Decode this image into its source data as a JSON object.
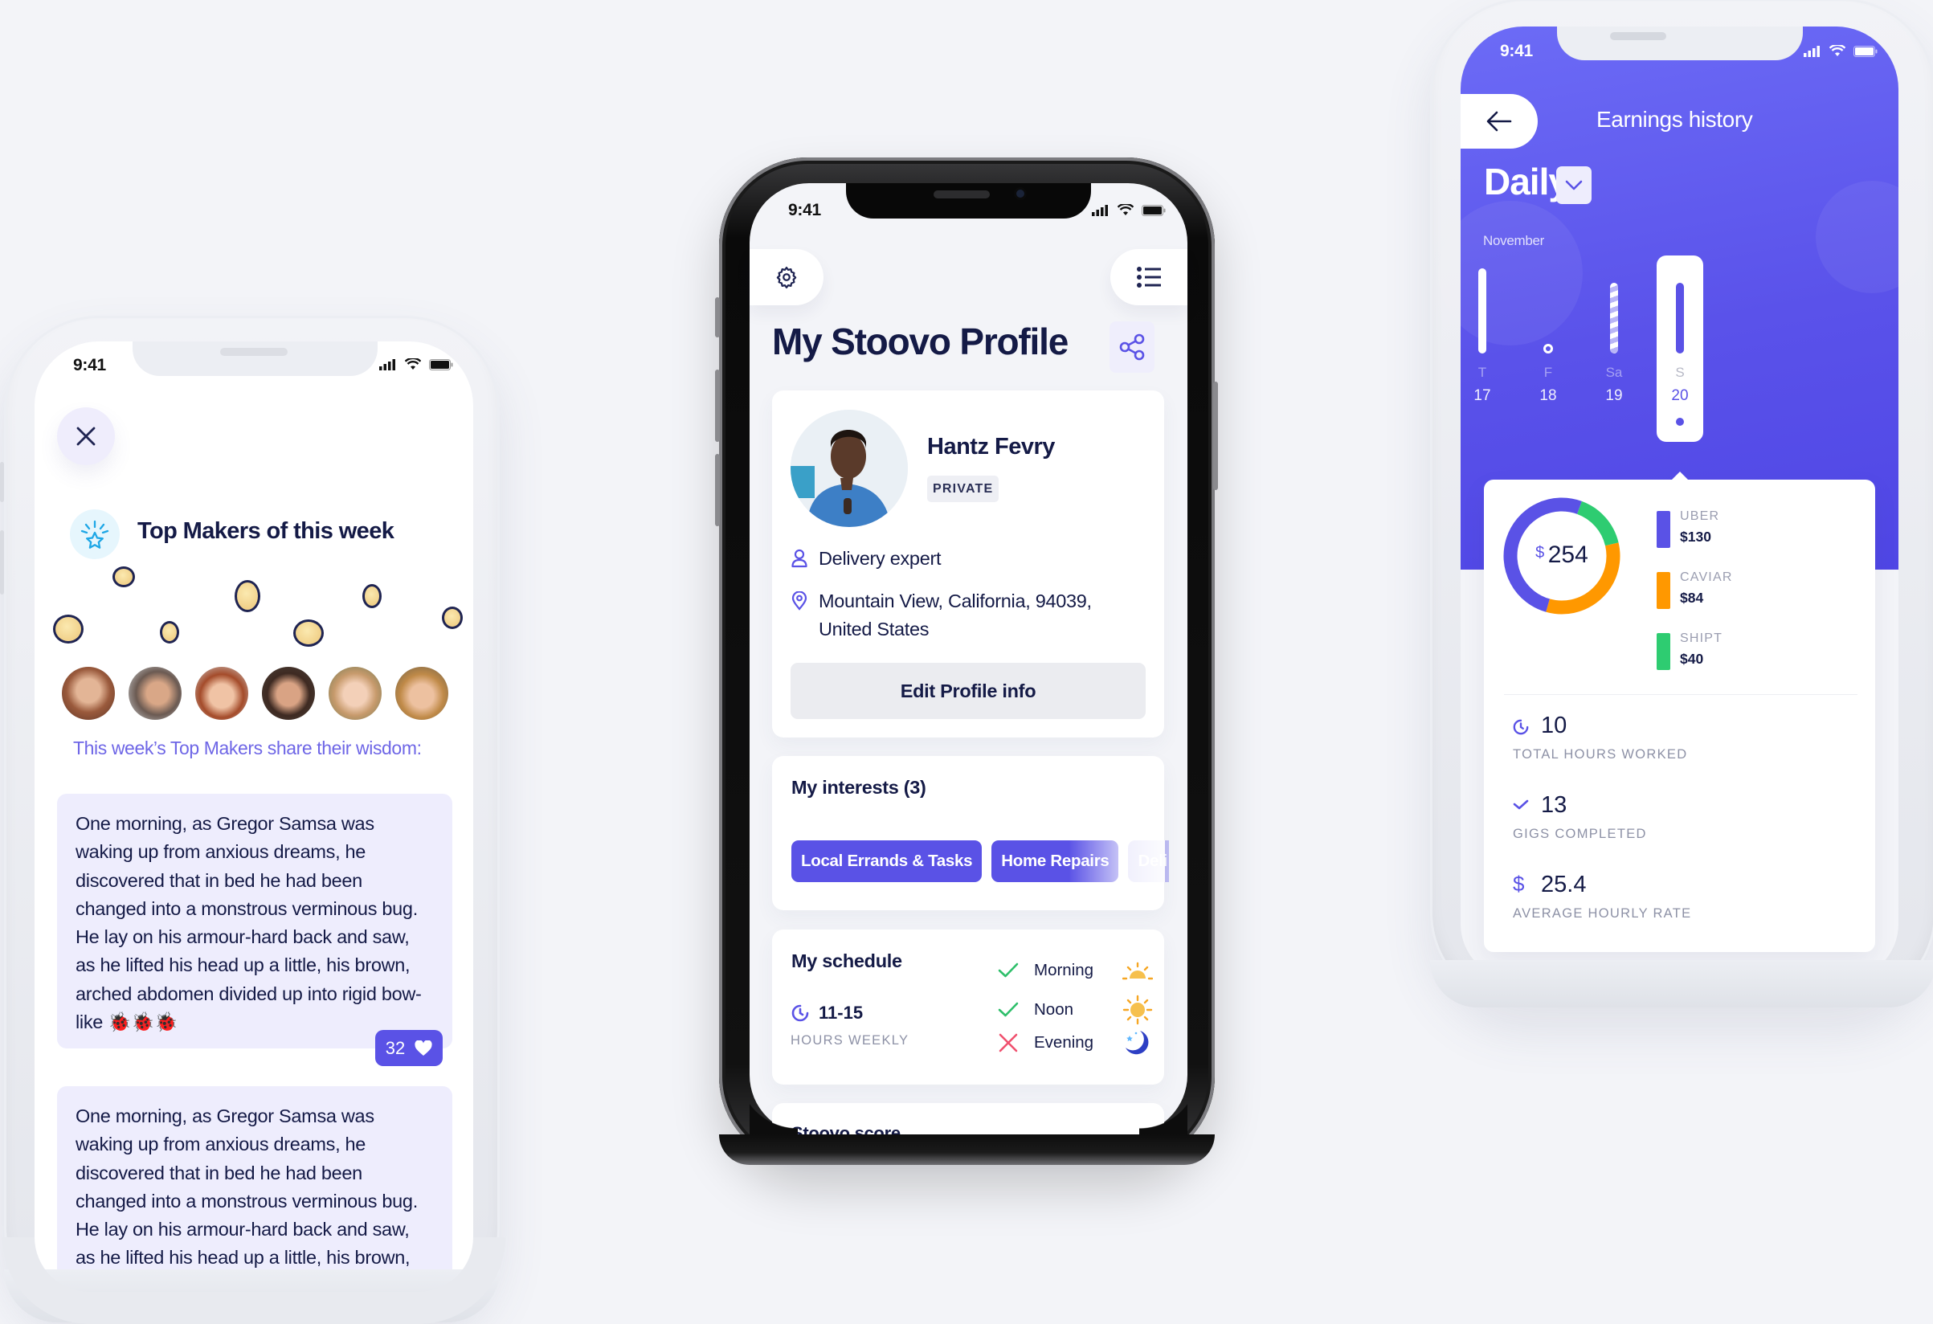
{
  "status_bar": {
    "time": "9:41"
  },
  "top_makers": {
    "title": "Top Makers of this week",
    "subtitle": "This week’s Top Makers share their wisdom:",
    "close_icon": "close-icon",
    "avatars": [
      "maker-1",
      "maker-2",
      "maker-3",
      "maker-4",
      "maker-5",
      "maker-6"
    ],
    "posts": [
      {
        "text": "One morning, as Gregor Samsa was waking up from anxious dreams, he discovered that in bed he had been changed into a monstrous verminous bug. He lay on his armour-hard back and saw, as he lifted his head up a little, his brown, arched abdomen divided up into rigid bow-like 🐞🐞🐞",
        "likes": "32"
      },
      {
        "text": "One morning, as Gregor Samsa was waking up from anxious dreams, he discovered that in bed he had been changed into a monstrous verminous bug. He lay on his armour-hard back and saw, as he lifted his head up a little, his brown, arched abdomen divided up into rigid"
      }
    ]
  },
  "profile": {
    "title": "My Stoovo Profile",
    "name": "Hantz Fevry",
    "badge": "PRIVATE",
    "role": "Delivery expert",
    "location_line1": "Mountain View, California, 94039,",
    "location_line2": "United States",
    "edit_button": "Edit Profile info",
    "interests_title": "My interests (3)",
    "interests": [
      "Local Errands & Tasks",
      "Home Repairs",
      "Deli"
    ],
    "schedule_title": "My schedule",
    "hours_value": "11-15",
    "hours_label": "HOURS WEEKLY",
    "schedule": [
      {
        "label": "Morning",
        "enabled": true,
        "icon": "sunrise-icon"
      },
      {
        "label": "Noon",
        "enabled": true,
        "icon": "sun-icon"
      },
      {
        "label": "Evening",
        "enabled": false,
        "icon": "moon-icon"
      }
    ],
    "next_section": "Stoovo score",
    "colors": {
      "accent": "#5a52e6",
      "check": "#2fbf6b",
      "cross": "#f0506e"
    }
  },
  "earnings": {
    "title": "Earnings history",
    "period": "Daily",
    "month": "November",
    "days": [
      {
        "letter": "T",
        "date": "17",
        "relative_height": 1.0,
        "style": "solid"
      },
      {
        "letter": "F",
        "date": "18",
        "relative_height": 0.0,
        "style": "dot"
      },
      {
        "letter": "Sa",
        "date": "19",
        "relative_height": 0.83,
        "style": "striped"
      },
      {
        "letter": "S",
        "date": "20",
        "relative_height": 0.83,
        "style": "selected"
      }
    ],
    "total_currency": "$",
    "total": "254",
    "stats": [
      {
        "value": "10",
        "label": "TOTAL HOURS WORKED",
        "icon": "clock-icon"
      },
      {
        "value": "13",
        "label": "GIGS COMPLETED",
        "icon": "check-icon"
      },
      {
        "value": "25.4",
        "label": "AVERAGE HOURLY RATE",
        "icon": "dollar-icon"
      }
    ]
  },
  "chart_data": {
    "type": "pie",
    "title": "$254",
    "categories": [
      "UBER",
      "CAVIAR",
      "SHIPT"
    ],
    "values": [
      130,
      84,
      40
    ],
    "labels": [
      "$130",
      "$84",
      "$40"
    ],
    "colors": [
      "#5a52e6",
      "#ff9800",
      "#2ecc71"
    ],
    "legend": "right"
  }
}
